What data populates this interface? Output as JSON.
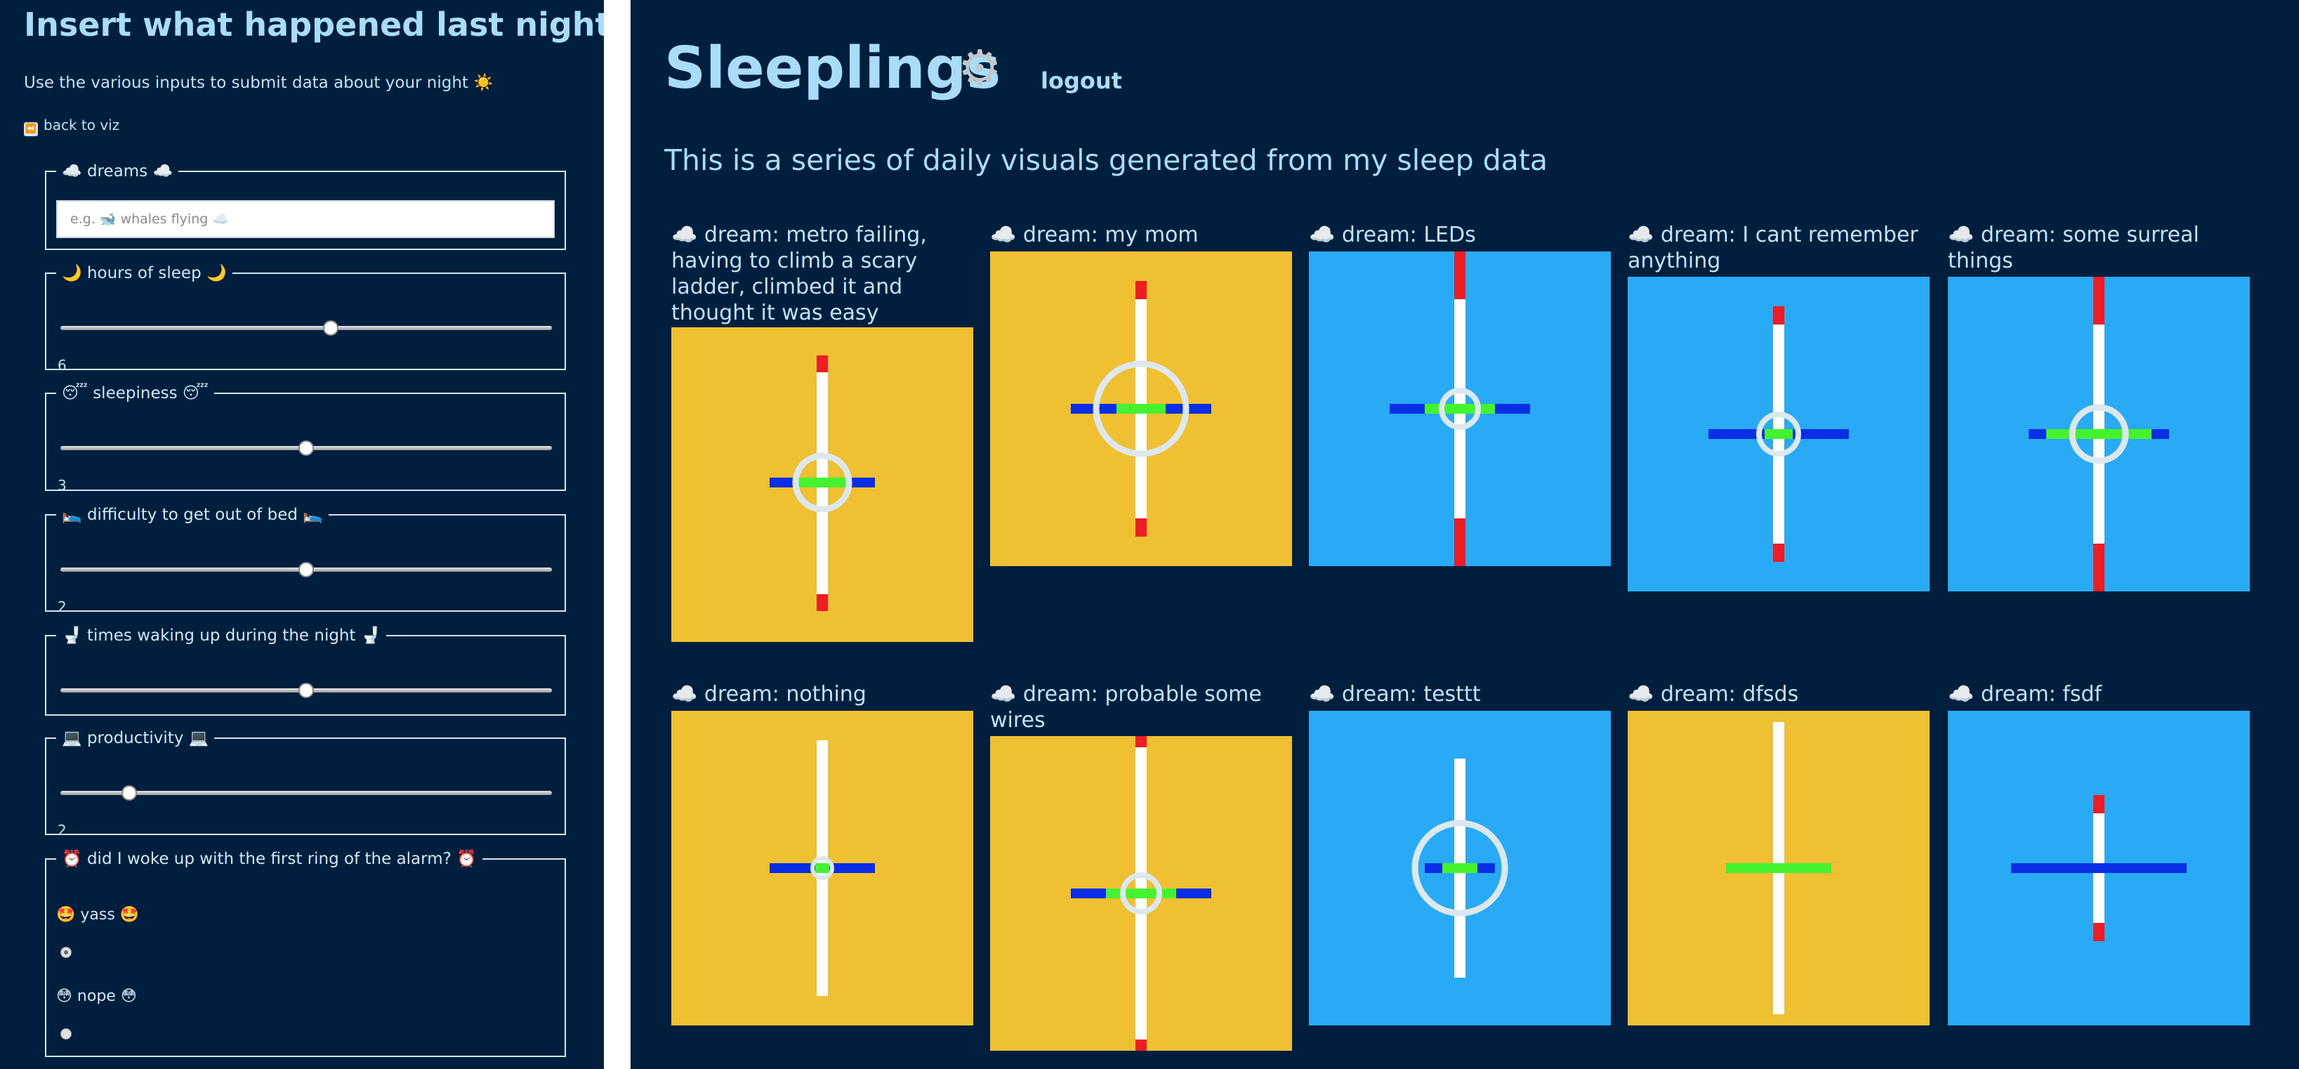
{
  "form": {
    "title": "Insert what happened last night 😳",
    "subtitle": "Use the various inputs to submit data about your night ☀️",
    "back_link": "back to viz",
    "back_icon": "rewind-icon",
    "dreams": {
      "legend": "☁️ dreams ☁️",
      "placeholder": "e.g. 🐋 whales flying ☁️",
      "value": ""
    },
    "hours": {
      "legend": "🌙 hours of sleep 🌙",
      "value": "6",
      "fraction": 0.55
    },
    "sleepiness": {
      "legend": "😴 sleepiness 😴",
      "value": "3",
      "fraction": 0.5
    },
    "difficulty": {
      "legend": "🛌 difficulty to get out of bed 🛌",
      "value": "2",
      "fraction": 0.5
    },
    "waking": {
      "legend": "🚽 times waking up during the night 🚽",
      "fraction": 0.5
    },
    "productivity": {
      "legend": "💻 productivity 💻",
      "value": "2",
      "fraction": 0.14
    },
    "alarm": {
      "legend": "⏰ did I woke up with the first ring of the alarm? ⏰",
      "options": [
        {
          "label": "🤩 yass 🤩",
          "checked": true
        },
        {
          "label": "😳 nope 😳",
          "checked": false
        }
      ]
    }
  },
  "viz": {
    "title": "Sleeplings",
    "settings_icon": "gear-icon",
    "logout": "logout",
    "subtitle": "This is a series of daily visuals generated from my sleep data",
    "colors": {
      "yellow": "#efc032",
      "blue": "#29aaf5",
      "white": "#ffffff",
      "red": "#ee1d24",
      "dark_blue": "#0a2ee6",
      "green": "#44f22d",
      "ring": "#dce8ee"
    },
    "cards": [
      {
        "caption": "☁️ dream: metro failing, having to climb a scary ladder, climbed it and thought it was easy",
        "bg": "yellow"
      },
      {
        "caption": "☁️ dream: my mom",
        "bg": "yellow"
      },
      {
        "caption": "☁️ dream: LEDs",
        "bg": "blue"
      },
      {
        "caption": "☁️ dream: I cant remember anything",
        "bg": "blue"
      },
      {
        "caption": "☁️ dream: some surreal things",
        "bg": "blue"
      },
      {
        "caption": "☁️ dream: nothing",
        "bg": "yellow"
      },
      {
        "caption": "☁️ dream: probable some wires",
        "bg": "yellow"
      },
      {
        "caption": "☁️ dream: testtt",
        "bg": "blue"
      },
      {
        "caption": "☁️ dream: dfsds",
        "bg": "yellow"
      },
      {
        "caption": "☁️ dream: fsdf",
        "bg": "blue"
      }
    ]
  }
}
